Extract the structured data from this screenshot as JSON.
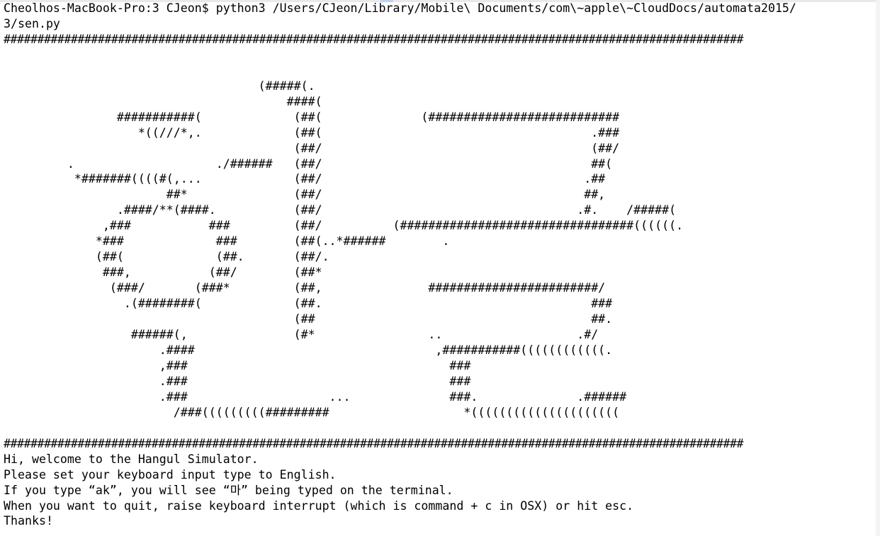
{
  "terminal": {
    "command_line": "Cheolhos-MacBook-Pro:3 CJeon$ python3 /Users/CJeon/Library/Mobile\\ Documents/com\\~apple\\~CloudDocs/automata2015/",
    "command_wrap": "3/sen.py",
    "hash_rule": "##############################################################################################################",
    "ascii_art": [
      "",
      "",
      "                                    (#####(.",
      "                                        ####(",
      "                ###########(             (##(              (###########################",
      "                   *((///*,.             (##(                                      .###",
      "                                         (##/                                      (##/",
      "         .                    ./######   (##/                                      ##(",
      "          *#######((((#(,...             (##/                                     .##",
      "                       ##*               (##/                                     ##,",
      "                .####/**(####.           (##/                                    .#.    /#####(",
      "              ,###           ###         (##/          (#################################((((((.",
      "             *###             ###        (##(..*######        .",
      "             (##(             (##.       (##/.",
      "              ###,           (##/        (##*",
      "               (###/       (###*         (##,               ########################/",
      "                 .(########(             (##.                                      ###",
      "                                         (##                                       ##.",
      "                  ######(,               (#*                ..                   .#/",
      "                      .####                                  ,###########((((((((((((.",
      "                      ,###                                     ###",
      "                      .###                                     ###",
      "                      .###                    ...              ###.              .######",
      "                        /###(((((((((#########                   *(((((((((((((((((((((",
      ""
    ],
    "messages": [
      "Hi, welcome to the Hangul Simulator.",
      "Please set your keyboard input type to English.",
      "If you type “ak”, you will see “마” being typed on the terminal.",
      "When you want to quit, raise keyboard interrupt (which is command + c in OSX) or hit esc.",
      "Thanks!"
    ]
  }
}
